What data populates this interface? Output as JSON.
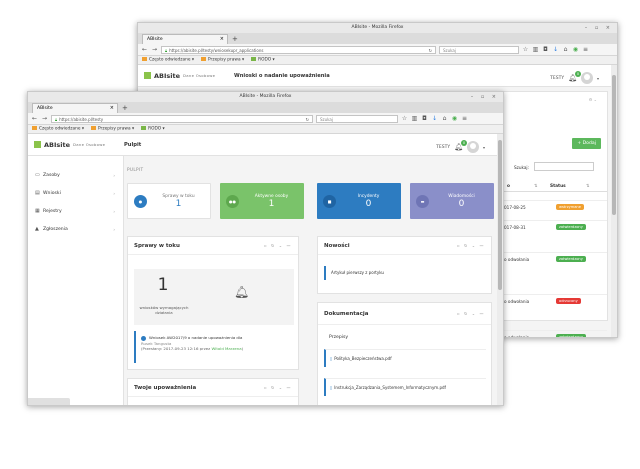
{
  "back_window": {
    "title": "ABIsite - Mozilla Firefox",
    "tab_label": "ABIsite",
    "url": "https://abisite.pl/testy/wniosekupr_applications",
    "search_placeholder": "Szukaj",
    "bookmarks": [
      "Często odwiedzane",
      "Przepisy prawa",
      "RODO"
    ],
    "logo": "ABIsite",
    "logo_sub": "Dane Osobowe",
    "header_title": "Wnioski o nadanie upoważnienia",
    "user": "TESTY",
    "notif_count": "0",
    "add_button": "+ Dodaj",
    "search_label": "Szukaj:",
    "table_headers": [
      "o",
      "Status"
    ],
    "rows": [
      {
        "col": "017-08-25",
        "status": "wstrzymane",
        "color": "#f0a030"
      },
      {
        "col": "017-08-31",
        "status": "zatwierdzony",
        "color": "#4caf50"
      },
      {
        "col": "o odwołania",
        "status": "zatwierdzony",
        "color": "#4caf50"
      },
      {
        "col": "o odwołania",
        "status": "odrzucony",
        "color": "#e53935"
      },
      {
        "col": "o odwołania",
        "status": "zatwierdzony",
        "color": "#4caf50"
      }
    ]
  },
  "front_window": {
    "title": "ABIsite - Mozilla Firefox",
    "tab_label": "ABIsite",
    "url": "https://abisite.pl/testy",
    "search_placeholder": "Szukaj",
    "bookmarks": [
      "Często odwiedzane",
      "Przepisy prawa",
      "RODO"
    ],
    "logo": "ABIsite",
    "logo_sub": "Dane Osobowe",
    "header_title": "Pulpit",
    "user": "TESTY",
    "notif_count": "0",
    "sidebar": [
      {
        "label": "Zasoby",
        "icon": "folder-icon",
        "glyph": "▭"
      },
      {
        "label": "Wnioski",
        "icon": "file-icon",
        "glyph": "▤"
      },
      {
        "label": "Rejestry",
        "icon": "list-icon",
        "glyph": "▦"
      },
      {
        "label": "Zgłoszenia",
        "icon": "warning-icon",
        "glyph": "▲"
      }
    ],
    "breadcrumb": "PULPIT",
    "stats": [
      {
        "label": "Sprawy w toku",
        "value": "1",
        "bg": "#ffffff",
        "fg": "#2d7cc1",
        "circle": "#2d7cc1",
        "icon": "bell-icon",
        "glyph": "●"
      },
      {
        "label": "Aktywne osoby",
        "value": "1",
        "bg": "#7ac36a",
        "fg": "#ffffff",
        "circle": "#5ea84e",
        "icon": "users-icon",
        "glyph": "●●"
      },
      {
        "label": "Incydenty",
        "value": "0",
        "bg": "#2d7cc1",
        "fg": "#ffffff",
        "circle": "#1f64a3",
        "icon": "shield-icon",
        "glyph": "■"
      },
      {
        "label": "Wiadomości",
        "value": "0",
        "bg": "#8a8fc9",
        "fg": "#ffffff",
        "circle": "#6f75b5",
        "icon": "mail-icon",
        "glyph": "▬"
      }
    ],
    "panels": {
      "cases": {
        "title": "Sprawy w toku",
        "big_number": "1",
        "big_label": "wniosków wymagających działania",
        "item_title": "Wniosek AW2017/9 o nadanie upoważnienia dla",
        "item_person": "Rusek Tangusta",
        "item_meta": "(Przesłany: 2017-09-23 12:16 przez",
        "item_author": "Witold Marzena",
        "item_meta_end": ")"
      },
      "news": {
        "title": "Nowości",
        "item": "Artykuł pierwszy z portyku"
      },
      "docs": {
        "title": "Dokumentacja",
        "section": "Przepisy",
        "files": [
          "Polityka_Bezpieczeństwa.pdf",
          "Instrukcja_Zarządzania_Systemem_Informatycznym.pdf"
        ]
      },
      "auth": {
        "title": "Twoje upoważnienia"
      }
    }
  }
}
